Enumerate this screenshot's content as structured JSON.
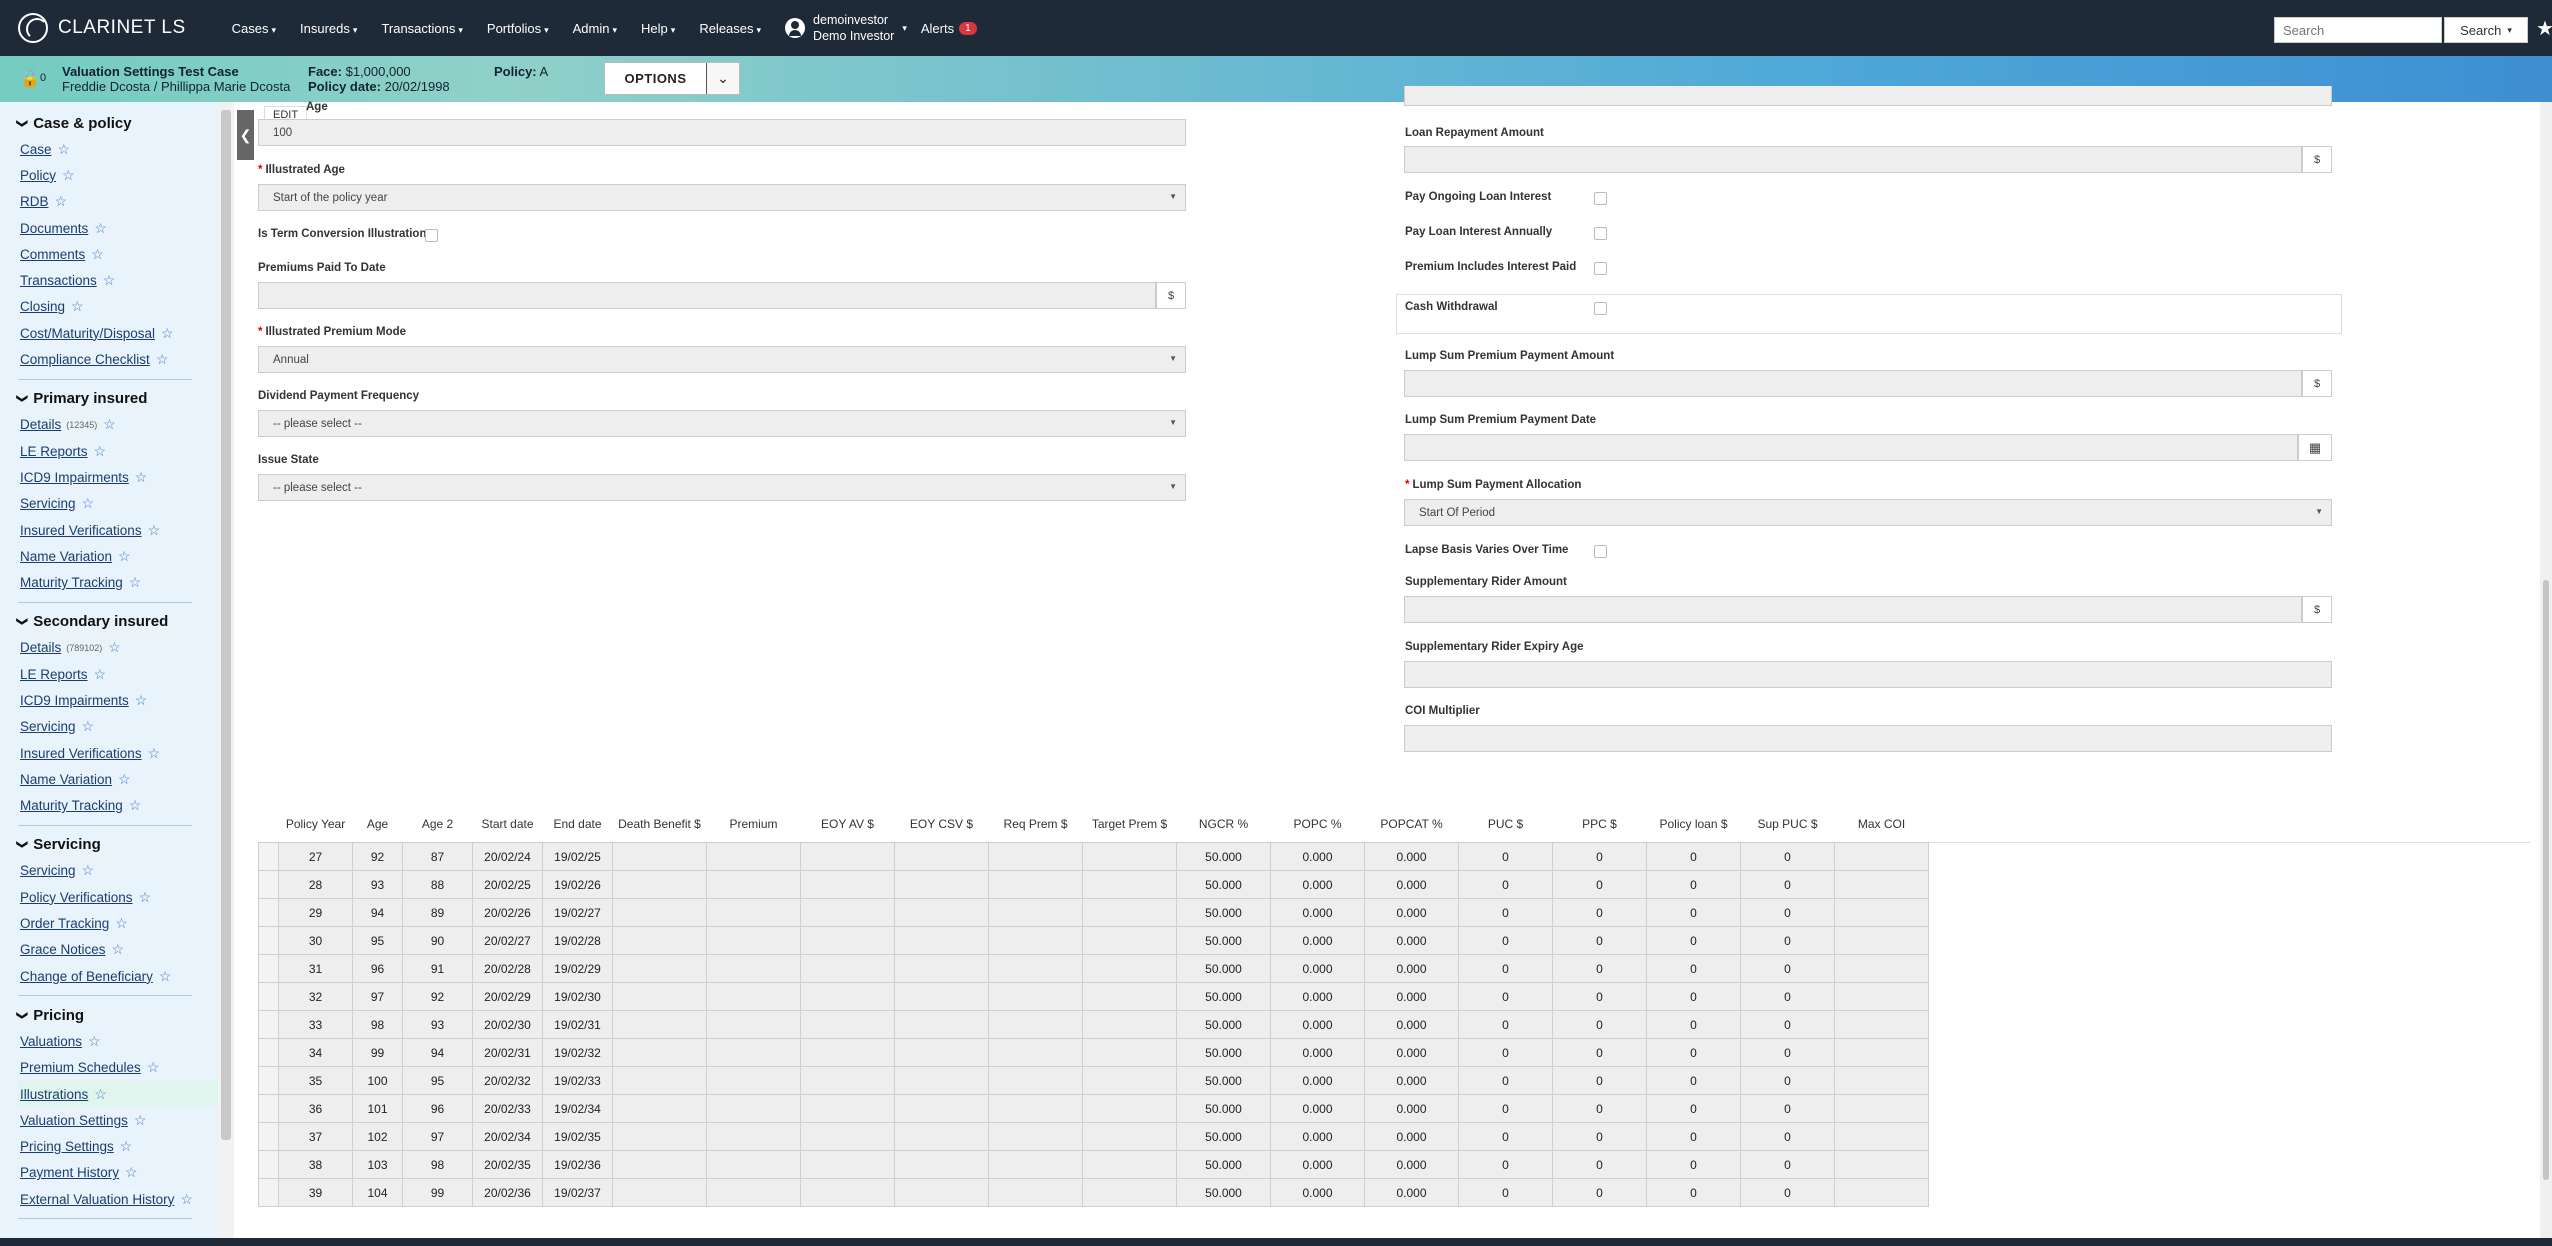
{
  "app": {
    "title": "CLARINET LS"
  },
  "nav": {
    "items": [
      "Cases",
      "Insureds",
      "Transactions",
      "Portfolios",
      "Admin",
      "Help",
      "Releases"
    ],
    "user_line1": "demoinvestor",
    "user_line2": "Demo Investor",
    "alerts_label": "Alerts",
    "alerts_count": "1",
    "search_placeholder": "Search",
    "search_button": "Search"
  },
  "case": {
    "lock_count": "0",
    "name": "Valuation Settings Test Case",
    "insureds": "Freddie Dcosta / Phillippa Marie Dcosta",
    "face_label": "Face:",
    "face_value": "$1,000,000",
    "policy_date_label": "Policy date:",
    "policy_date_value": "20/02/1998",
    "policy_label": "Policy:",
    "policy_value": "A",
    "options_label": "OPTIONS"
  },
  "sidebar": {
    "sections": [
      {
        "title": "Case & policy",
        "items": [
          {
            "label": "Case"
          },
          {
            "label": "Policy"
          },
          {
            "label": "RDB"
          },
          {
            "label": "Documents"
          },
          {
            "label": "Comments"
          },
          {
            "label": "Transactions"
          },
          {
            "label": "Closing"
          },
          {
            "label": "Cost/Maturity/Disposal"
          },
          {
            "label": "Compliance Checklist"
          }
        ]
      },
      {
        "title": "Primary insured",
        "items": [
          {
            "label": "Details",
            "sub": "(12345)"
          },
          {
            "label": "LE Reports"
          },
          {
            "label": "ICD9 Impairments"
          },
          {
            "label": "Servicing"
          },
          {
            "label": "Insured Verifications"
          },
          {
            "label": "Name Variation"
          },
          {
            "label": "Maturity Tracking"
          }
        ]
      },
      {
        "title": "Secondary insured",
        "items": [
          {
            "label": "Details",
            "sub": "(789102)"
          },
          {
            "label": "LE Reports"
          },
          {
            "label": "ICD9 Impairments"
          },
          {
            "label": "Servicing"
          },
          {
            "label": "Insured Verifications"
          },
          {
            "label": "Name Variation"
          },
          {
            "label": "Maturity Tracking"
          }
        ]
      },
      {
        "title": "Servicing",
        "items": [
          {
            "label": "Servicing"
          },
          {
            "label": "Policy Verifications"
          },
          {
            "label": "Order Tracking"
          },
          {
            "label": "Grace Notices"
          },
          {
            "label": "Change of Beneficiary"
          }
        ]
      },
      {
        "title": "Pricing",
        "items": [
          {
            "label": "Valuations"
          },
          {
            "label": "Premium Schedules"
          },
          {
            "label": "Illustrations",
            "active": true
          },
          {
            "label": "Valuation Settings"
          },
          {
            "label": "Pricing Settings"
          },
          {
            "label": "Payment History"
          },
          {
            "label": "External Valuation History"
          }
        ]
      }
    ]
  },
  "form": {
    "edit_label": "EDIT",
    "left": {
      "age_label": "Age",
      "age_value": "100",
      "illustrated_age_label": "Illustrated Age",
      "illustrated_age_value": "Start of the policy year",
      "term_conversion_label": "Is Term Conversion Illustration",
      "premiums_paid_label": "Premiums Paid To Date",
      "currency": "$",
      "premium_mode_label": "Illustrated Premium Mode",
      "premium_mode_value": "Annual",
      "dividend_label": "Dividend Payment Frequency",
      "please_select": "-- please select --",
      "issue_state_label": "Issue State"
    },
    "right": {
      "loan_repayment_label": "Loan Repayment Amount",
      "pay_ongoing_label": "Pay Ongoing Loan Interest",
      "pay_annually_label": "Pay Loan Interest Annually",
      "premium_includes_label": "Premium Includes Interest Paid",
      "cash_withdrawal_label": "Cash Withdrawal",
      "lump_sum_amount_label": "Lump Sum Premium Payment Amount",
      "lump_sum_date_label": "Lump Sum Premium Payment Date",
      "lump_sum_allocation_label": "Lump Sum Payment Allocation",
      "lump_sum_allocation_value": "Start Of Period",
      "lapse_basis_label": "Lapse Basis Varies Over Time",
      "supp_rider_amount_label": "Supplementary Rider Amount",
      "supp_rider_expiry_label": "Supplementary Rider Expiry Age",
      "coi_label": "COI Multiplier"
    }
  },
  "table": {
    "headers": [
      "Policy Year",
      "Age",
      "Age 2",
      "Start date",
      "End date",
      "Death Benefit $",
      "Premium",
      "EOY AV $",
      "EOY CSV $",
      "Req Prem $",
      "Target Prem $",
      "NGCR %",
      "POPC %",
      "POPCAT %",
      "PUC $",
      "PPC $",
      "Policy loan $",
      "Sup PUC $",
      "Max COI"
    ],
    "rows": [
      [
        "27",
        "92",
        "87",
        "20/02/24",
        "19/02/25",
        "",
        "",
        "",
        "",
        "",
        "",
        "50.000",
        "0.000",
        "0.000",
        "0",
        "0",
        "0",
        "0",
        ""
      ],
      [
        "28",
        "93",
        "88",
        "20/02/25",
        "19/02/26",
        "",
        "",
        "",
        "",
        "",
        "",
        "50.000",
        "0.000",
        "0.000",
        "0",
        "0",
        "0",
        "0",
        ""
      ],
      [
        "29",
        "94",
        "89",
        "20/02/26",
        "19/02/27",
        "",
        "",
        "",
        "",
        "",
        "",
        "50.000",
        "0.000",
        "0.000",
        "0",
        "0",
        "0",
        "0",
        ""
      ],
      [
        "30",
        "95",
        "90",
        "20/02/27",
        "19/02/28",
        "",
        "",
        "",
        "",
        "",
        "",
        "50.000",
        "0.000",
        "0.000",
        "0",
        "0",
        "0",
        "0",
        ""
      ],
      [
        "31",
        "96",
        "91",
        "20/02/28",
        "19/02/29",
        "",
        "",
        "",
        "",
        "",
        "",
        "50.000",
        "0.000",
        "0.000",
        "0",
        "0",
        "0",
        "0",
        ""
      ],
      [
        "32",
        "97",
        "92",
        "20/02/29",
        "19/02/30",
        "",
        "",
        "",
        "",
        "",
        "",
        "50.000",
        "0.000",
        "0.000",
        "0",
        "0",
        "0",
        "0",
        ""
      ],
      [
        "33",
        "98",
        "93",
        "20/02/30",
        "19/02/31",
        "",
        "",
        "",
        "",
        "",
        "",
        "50.000",
        "0.000",
        "0.000",
        "0",
        "0",
        "0",
        "0",
        ""
      ],
      [
        "34",
        "99",
        "94",
        "20/02/31",
        "19/02/32",
        "",
        "",
        "",
        "",
        "",
        "",
        "50.000",
        "0.000",
        "0.000",
        "0",
        "0",
        "0",
        "0",
        ""
      ],
      [
        "35",
        "100",
        "95",
        "20/02/32",
        "19/02/33",
        "",
        "",
        "",
        "",
        "",
        "",
        "50.000",
        "0.000",
        "0.000",
        "0",
        "0",
        "0",
        "0",
        ""
      ],
      [
        "36",
        "101",
        "96",
        "20/02/33",
        "19/02/34",
        "",
        "",
        "",
        "",
        "",
        "",
        "50.000",
        "0.000",
        "0.000",
        "0",
        "0",
        "0",
        "0",
        ""
      ],
      [
        "37",
        "102",
        "97",
        "20/02/34",
        "19/02/35",
        "",
        "",
        "",
        "",
        "",
        "",
        "50.000",
        "0.000",
        "0.000",
        "0",
        "0",
        "0",
        "0",
        ""
      ],
      [
        "38",
        "103",
        "98",
        "20/02/35",
        "19/02/36",
        "",
        "",
        "",
        "",
        "",
        "",
        "50.000",
        "0.000",
        "0.000",
        "0",
        "0",
        "0",
        "0",
        ""
      ],
      [
        "39",
        "104",
        "99",
        "20/02/36",
        "19/02/37",
        "",
        "",
        "",
        "",
        "",
        "",
        "50.000",
        "0.000",
        "0.000",
        "0",
        "0",
        "0",
        "0",
        ""
      ]
    ]
  },
  "colors": {
    "nav_bg": "#1e2a38",
    "sidebar_bg": "#e9f3fb",
    "link": "#1a3e6e",
    "star": "#4a7fc4",
    "alert": "#d9363e"
  }
}
